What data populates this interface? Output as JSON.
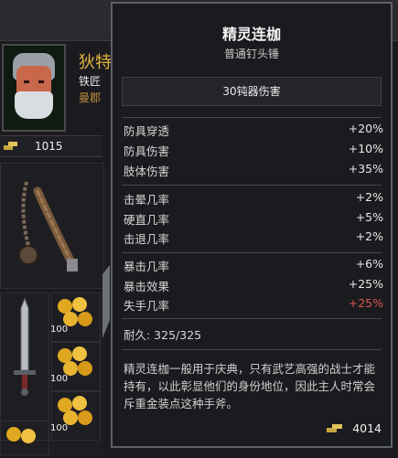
{
  "character": {
    "name": "狄特",
    "job": "铁匠",
    "town": "曼郡",
    "money": "1015"
  },
  "inventory": {
    "coin_counts": [
      "100",
      "100",
      "100"
    ]
  },
  "tooltip": {
    "title": "精灵连枷",
    "subtitle": "普通钉头锤",
    "damage": "30钝器伤害",
    "stats_group1": [
      {
        "label": "防具穿透",
        "value": "+20%"
      },
      {
        "label": "防具伤害",
        "value": "+10%"
      },
      {
        "label": "肢体伤害",
        "value": "+35%"
      }
    ],
    "stats_group2": [
      {
        "label": "击晕几率",
        "value": "+2%"
      },
      {
        "label": "硬直几率",
        "value": "+5%"
      },
      {
        "label": "击退几率",
        "value": "+2%"
      }
    ],
    "stats_group3": [
      {
        "label": "暴击几率",
        "value": "+6%"
      },
      {
        "label": "暴击效果",
        "value": "+25%"
      },
      {
        "label": "失手几率",
        "value": "+25%",
        "negative": true
      }
    ],
    "durability": "耐久: 325/325",
    "description": "精灵连枷一般用于庆典，只有武艺高强的战士才能持有，以此彰显他们的身份地位，因此主人时常会斥重金装点这种手斧。",
    "price": "4014"
  },
  "colors": {
    "negative": "#d9584e",
    "gold_text": "#e0b43c",
    "border": "#5e6068"
  }
}
